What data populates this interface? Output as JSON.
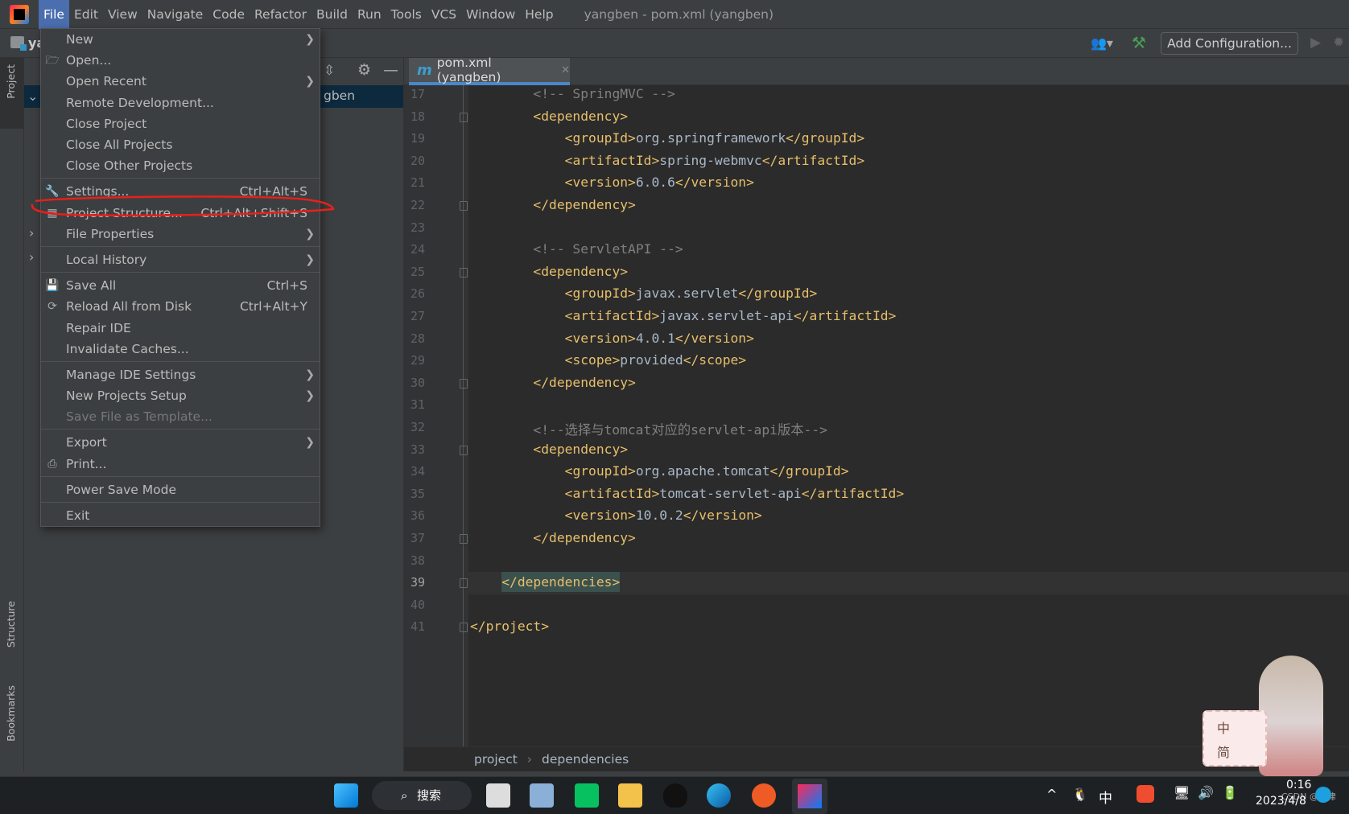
{
  "menubar": {
    "items": [
      "File",
      "Edit",
      "View",
      "Navigate",
      "Code",
      "Refactor",
      "Build",
      "Run",
      "Tools",
      "VCS",
      "Window",
      "Help"
    ],
    "active": "File",
    "title": "yangben - pom.xml (yangben)"
  },
  "toolbar": {
    "project_label": "ya",
    "add_config": "Add Configuration..."
  },
  "stripe": {
    "project": "Project",
    "structure": "Structure",
    "bookmarks": "Bookmarks"
  },
  "project_panel": {
    "selected_row": "gben"
  },
  "tab": {
    "icon": "m",
    "label": "pom.xml (yangben)"
  },
  "file_menu": [
    {
      "label": "New",
      "submenu": true
    },
    {
      "label": "Open...",
      "icon": "folder-open-icon"
    },
    {
      "label": "Open Recent",
      "submenu": true
    },
    {
      "label": "Remote Development..."
    },
    {
      "label": "Close Project"
    },
    {
      "label": "Close All Projects"
    },
    {
      "label": "Close Other Projects",
      "sep_after": true
    },
    {
      "label": "Settings...",
      "shortcut": "Ctrl+Alt+S",
      "icon": "wrench-icon"
    },
    {
      "label": "Project Structure...",
      "shortcut": "Ctrl+Alt+Shift+S",
      "icon": "project-structure-icon",
      "highlighted_by_annotation": true
    },
    {
      "label": "File Properties",
      "submenu": true,
      "sep_after": true
    },
    {
      "label": "Local History",
      "submenu": true,
      "sep_after": true
    },
    {
      "label": "Save All",
      "shortcut": "Ctrl+S",
      "icon": "save-icon"
    },
    {
      "label": "Reload All from Disk",
      "shortcut": "Ctrl+Alt+Y",
      "icon": "reload-icon"
    },
    {
      "label": "Repair IDE"
    },
    {
      "label": "Invalidate Caches...",
      "sep_after": true
    },
    {
      "label": "Manage IDE Settings",
      "submenu": true
    },
    {
      "label": "New Projects Setup",
      "submenu": true
    },
    {
      "label": "Save File as Template...",
      "disabled": true,
      "sep_after": true
    },
    {
      "label": "Export",
      "submenu": true
    },
    {
      "label": "Print...",
      "icon": "print-icon",
      "sep_after": true
    },
    {
      "label": "Power Save Mode",
      "sep_after": true
    },
    {
      "label": "Exit"
    }
  ],
  "editor": {
    "first_line": 17,
    "current_line": 39,
    "lines": [
      "        <!-- SpringMVC -->",
      "        <dependency>",
      "            <groupId>org.springframework</groupId>",
      "            <artifactId>spring-webmvc</artifactId>",
      "            <version>6.0.6</version>",
      "        </dependency>",
      "",
      "        <!-- ServletAPI -->",
      "        <dependency>",
      "            <groupId>javax.servlet</groupId>",
      "            <artifactId>javax.servlet-api</artifactId>",
      "            <version>4.0.1</version>",
      "            <scope>provided</scope>",
      "        </dependency>",
      "",
      "        <!--选择与tomcat对应的servlet-api版本-->",
      "        <dependency>",
      "            <groupId>org.apache.tomcat</groupId>",
      "            <artifactId>tomcat-servlet-api</artifactId>",
      "            <version>10.0.2</version>",
      "        </dependency>",
      "",
      "    </dependencies>",
      "",
      "</project>"
    ],
    "fold_lines": [
      18,
      22,
      25,
      30,
      33,
      37,
      39,
      41
    ]
  },
  "breadcrumb": [
    "project",
    "dependencies"
  ],
  "ime_widget": {
    "line1": "中",
    "line2": "简"
  },
  "taskbar": {
    "search": "搜索",
    "ime": "中",
    "time": "0:16",
    "date": "2023/4/8",
    "watermark": "CSDN @柠律"
  },
  "colors": {
    "accent": "#4b6eaf",
    "tag": "#e8bf6a",
    "comment": "#808080",
    "text": "#a9b7c6",
    "annotation": "#e8201a"
  }
}
